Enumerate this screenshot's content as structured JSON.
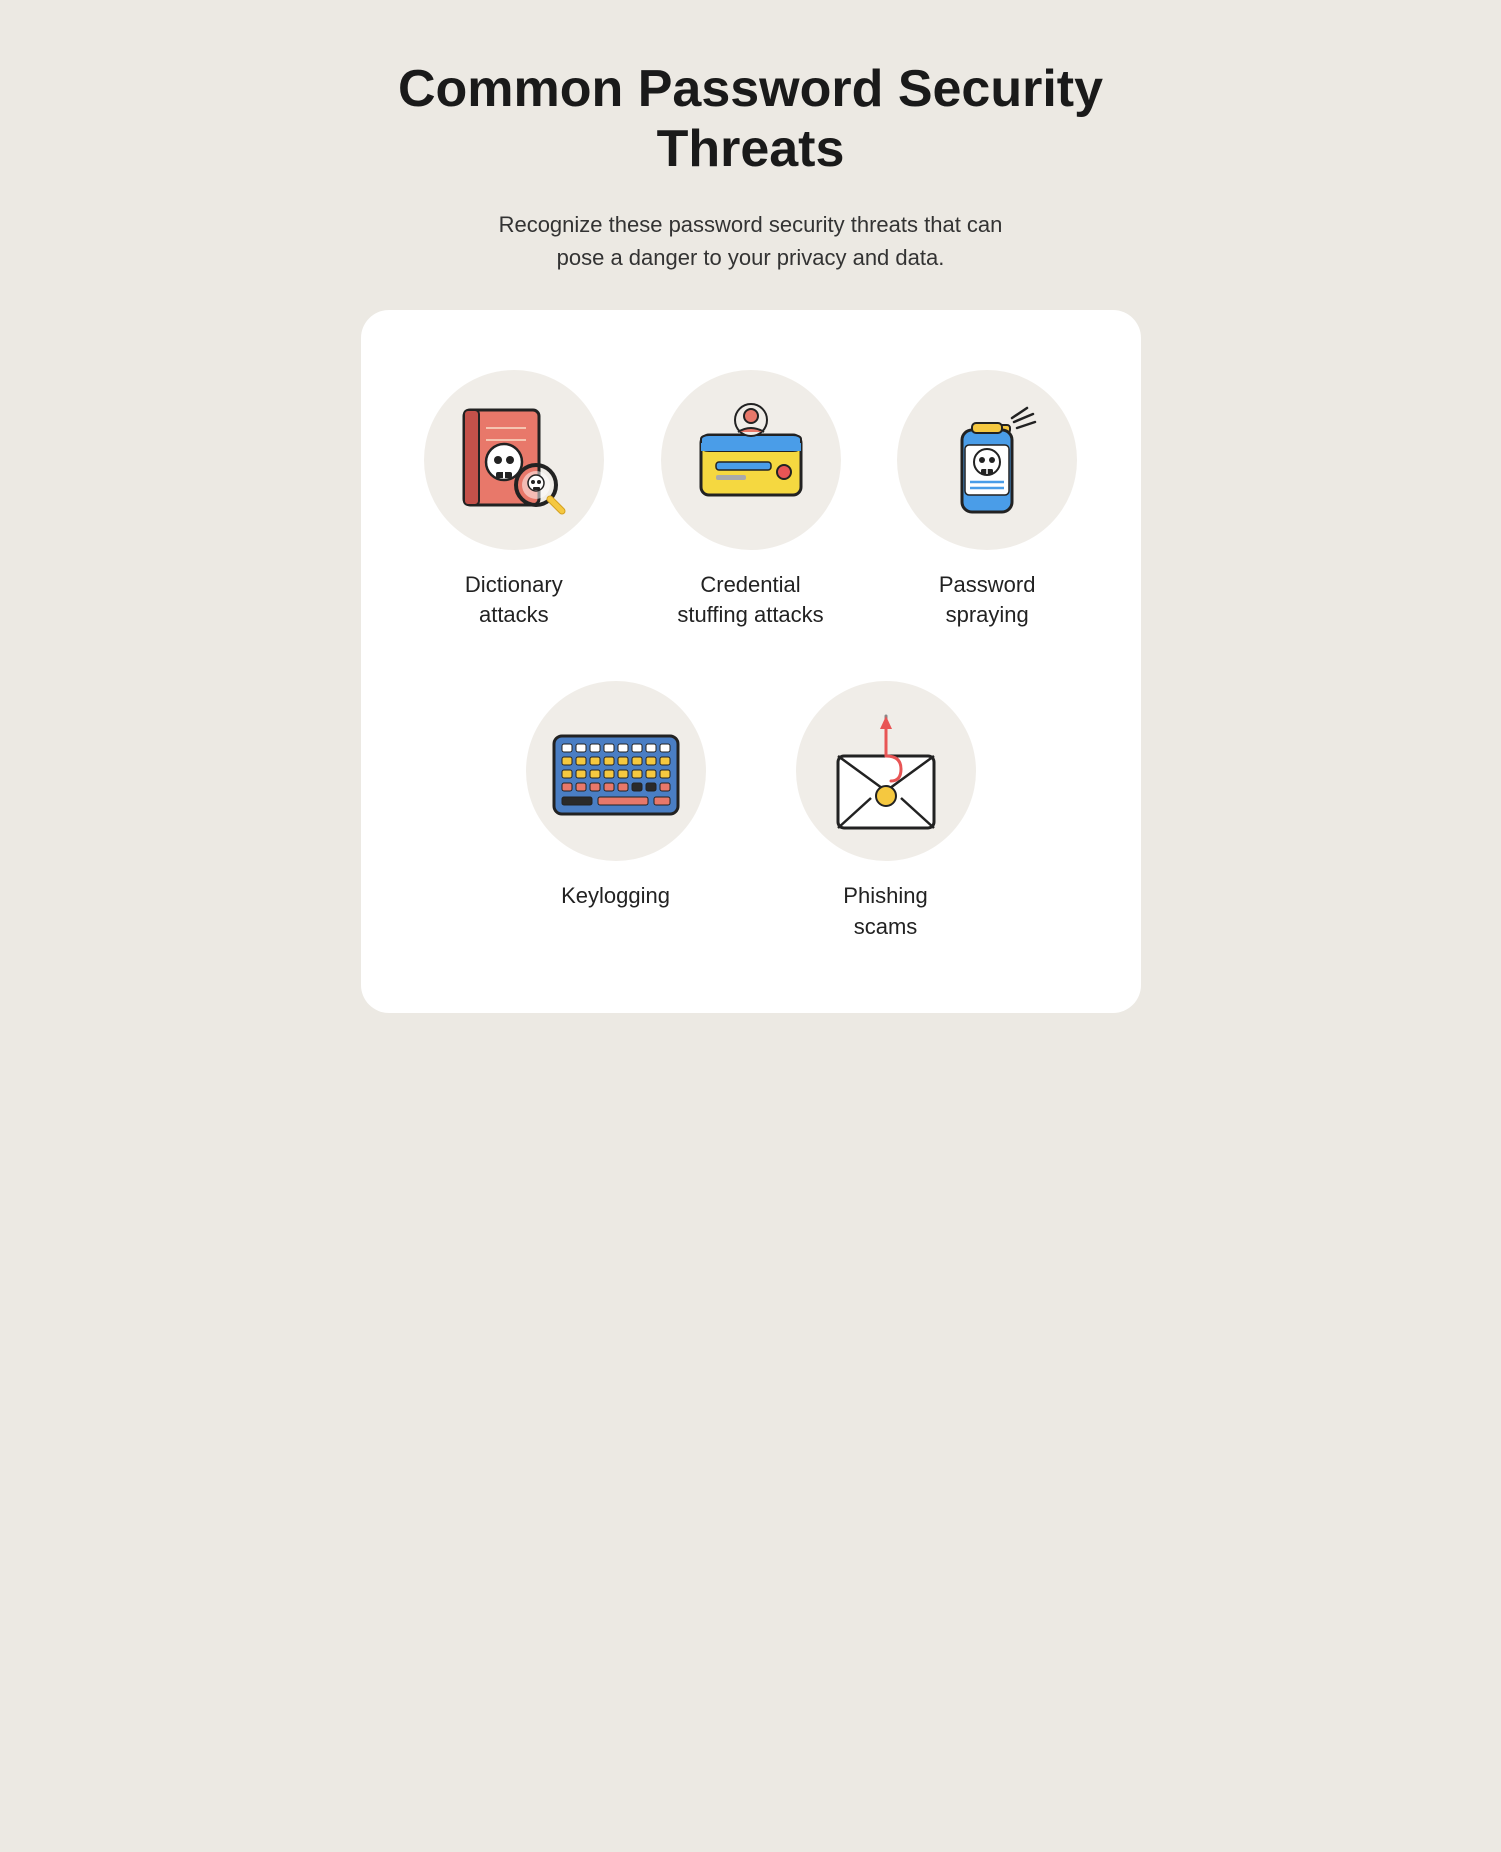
{
  "page": {
    "title": "Common Password Security Threats",
    "subtitle": "Recognize these password security threats that can pose a danger to your privacy and data.",
    "threats": [
      {
        "id": "dictionary-attacks",
        "label": "Dictionary\nattacks",
        "icon": "dictionary"
      },
      {
        "id": "credential-stuffing",
        "label": "Credential\nstuffing attacks",
        "icon": "credential"
      },
      {
        "id": "password-spraying",
        "label": "Password\nspraying",
        "icon": "spray"
      },
      {
        "id": "keylogging",
        "label": "Keylogging",
        "icon": "keyboard"
      },
      {
        "id": "phishing-scams",
        "label": "Phishing\nscams",
        "icon": "phishing"
      }
    ]
  }
}
